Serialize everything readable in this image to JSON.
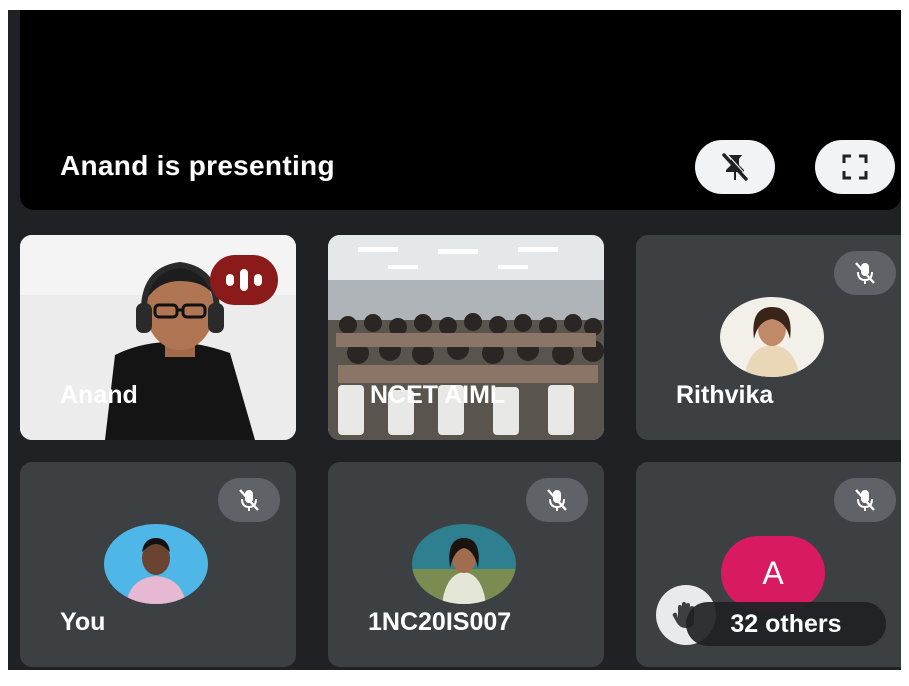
{
  "presentation": {
    "label": "Anand is presenting",
    "unpin_icon": "pin-off-icon",
    "fullscreen_icon": "fullscreen-icon"
  },
  "tiles": [
    {
      "name": "Anand",
      "type": "video",
      "speaking": true,
      "icon": "audio-level-icon"
    },
    {
      "name": "NCET AIML",
      "type": "video"
    },
    {
      "name": "Rithvika",
      "type": "avatar",
      "muted": true
    },
    {
      "name": "You",
      "type": "avatar",
      "muted": true
    },
    {
      "name": "1NC20IS007",
      "type": "avatar",
      "muted": true
    },
    {
      "type": "overflow",
      "avatar_letter": "A",
      "others_label": "32 others",
      "muted": true,
      "hand_icon": "raised-hand-icon"
    }
  ],
  "colors": {
    "background": "#202124",
    "tile": "#3c4043",
    "speaking": "#8b1a1a",
    "avatar_letter_bg": "#d81b60"
  }
}
